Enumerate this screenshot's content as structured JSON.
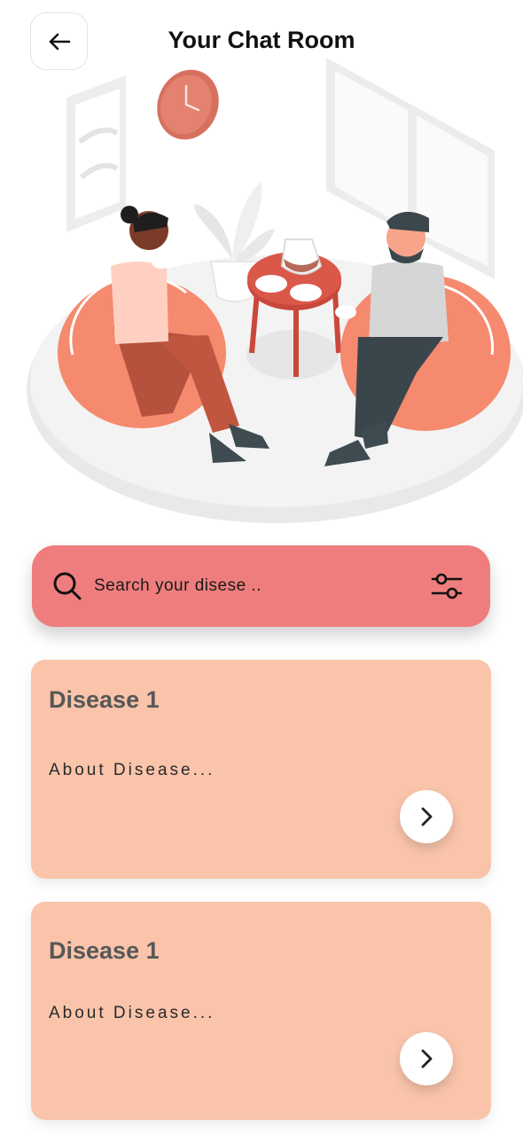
{
  "header": {
    "title": "Your Chat Room",
    "back_icon": "arrow-left-icon"
  },
  "search": {
    "placeholder": "Search your disese ..",
    "value": "",
    "search_icon": "search-icon",
    "filter_icon": "sliders-icon"
  },
  "cards": [
    {
      "title": "Disease 1",
      "description": "About Disease...",
      "action_icon": "chevron-right-icon"
    },
    {
      "title": "Disease 1",
      "description": "About Disease...",
      "action_icon": "chevron-right-icon"
    }
  ],
  "colors": {
    "search_bg": "#ef7d7d",
    "card_bg": "#f9c4aa",
    "accent": "#f08070"
  }
}
